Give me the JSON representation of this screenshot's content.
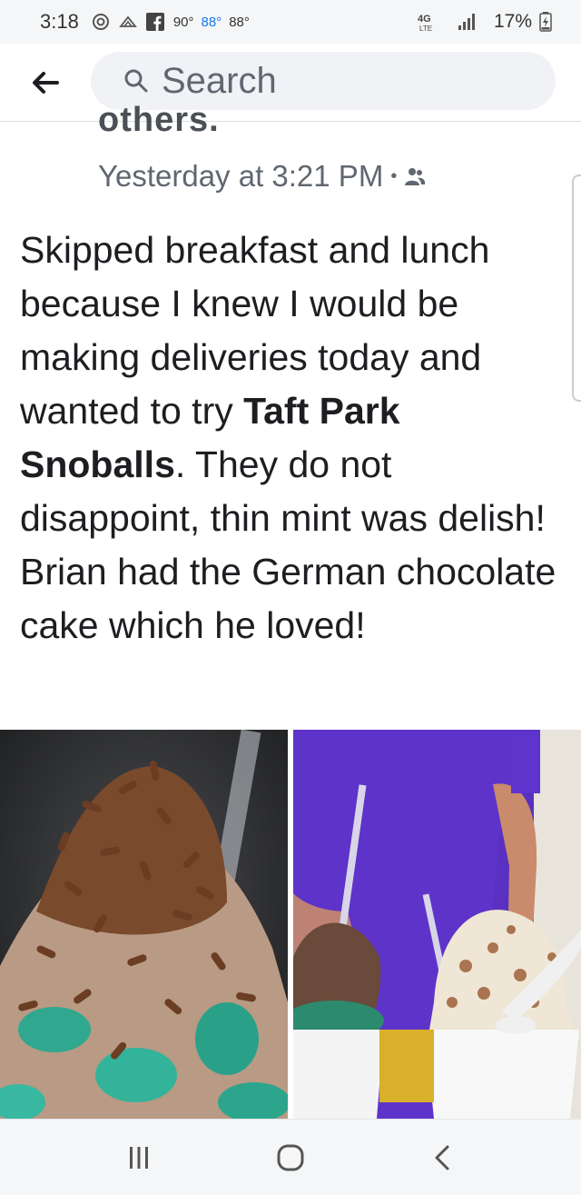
{
  "status_bar": {
    "time": "3:18",
    "temp_1": "90°",
    "temp_2": "88°",
    "temp_3": "88°",
    "network_badge": "4G",
    "battery_text": "17%",
    "colors": {
      "blue_temp": "#1877f2"
    }
  },
  "header": {
    "search_placeholder": "Search"
  },
  "post": {
    "cutoff_line": "others.",
    "timestamp": "Yesterday at 3:21 PM",
    "audience_icon": "friends-icon",
    "body": {
      "part1": "Skipped breakfast and lunch because I knew I would be making deliveries today and wanted to try ",
      "bold": "Taft Park Snoballs",
      "part2": ". They do not disappoint, thin mint was delish! Brian had the German chocolate cake which he loved!"
    }
  },
  "photos": [
    {
      "icon": "snoball-chocolate-sprinkles-photo"
    },
    {
      "icon": "snoballs-held-by-person-photo"
    }
  ],
  "nav_bar": {
    "recent_icon": "recent-apps-icon",
    "home_icon": "home-icon",
    "back_icon": "back-icon"
  }
}
